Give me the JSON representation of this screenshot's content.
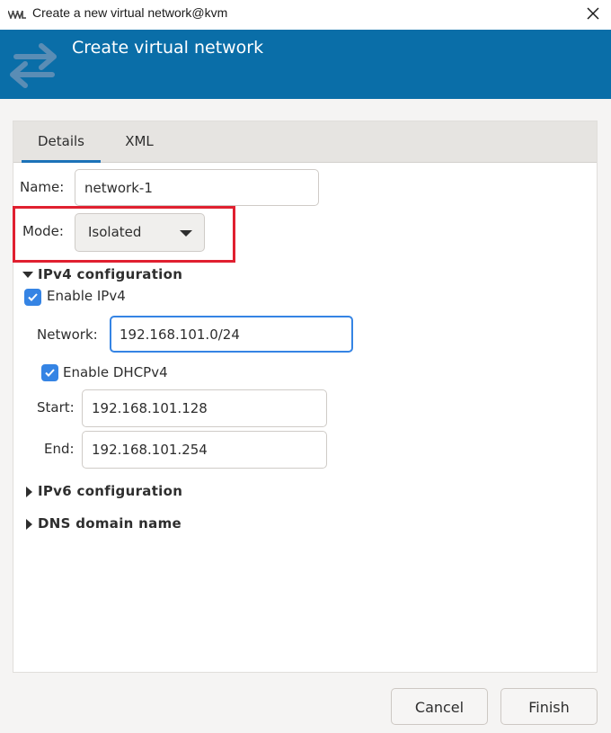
{
  "window": {
    "title": "Create a new virtual network@kvm"
  },
  "banner": {
    "title": "Create virtual network",
    "background": "#0a6ea8"
  },
  "tabs": [
    {
      "label": "Details",
      "active": true
    },
    {
      "label": "XML",
      "active": false
    }
  ],
  "form": {
    "name_label": "Name:",
    "name_value": "network-1",
    "mode_label": "Mode:",
    "mode_value": "Isolated"
  },
  "ipv4": {
    "section_label": "IPv4 configuration",
    "expanded": true,
    "enable_label": "Enable IPv4",
    "enable_checked": true,
    "network_label": "Network:",
    "network_value": "192.168.101.0/24",
    "dhcp_label": "Enable DHCPv4",
    "dhcp_checked": true,
    "start_label": "Start:",
    "start_value": "192.168.101.128",
    "end_label": "End:",
    "end_value": "192.168.101.254"
  },
  "ipv6": {
    "section_label": "IPv6 configuration",
    "expanded": false
  },
  "dns": {
    "section_label": "DNS domain name",
    "expanded": false
  },
  "buttons": {
    "cancel": "Cancel",
    "finish": "Finish"
  },
  "colors": {
    "accent": "#3584e4",
    "highlight": "#e02030"
  }
}
